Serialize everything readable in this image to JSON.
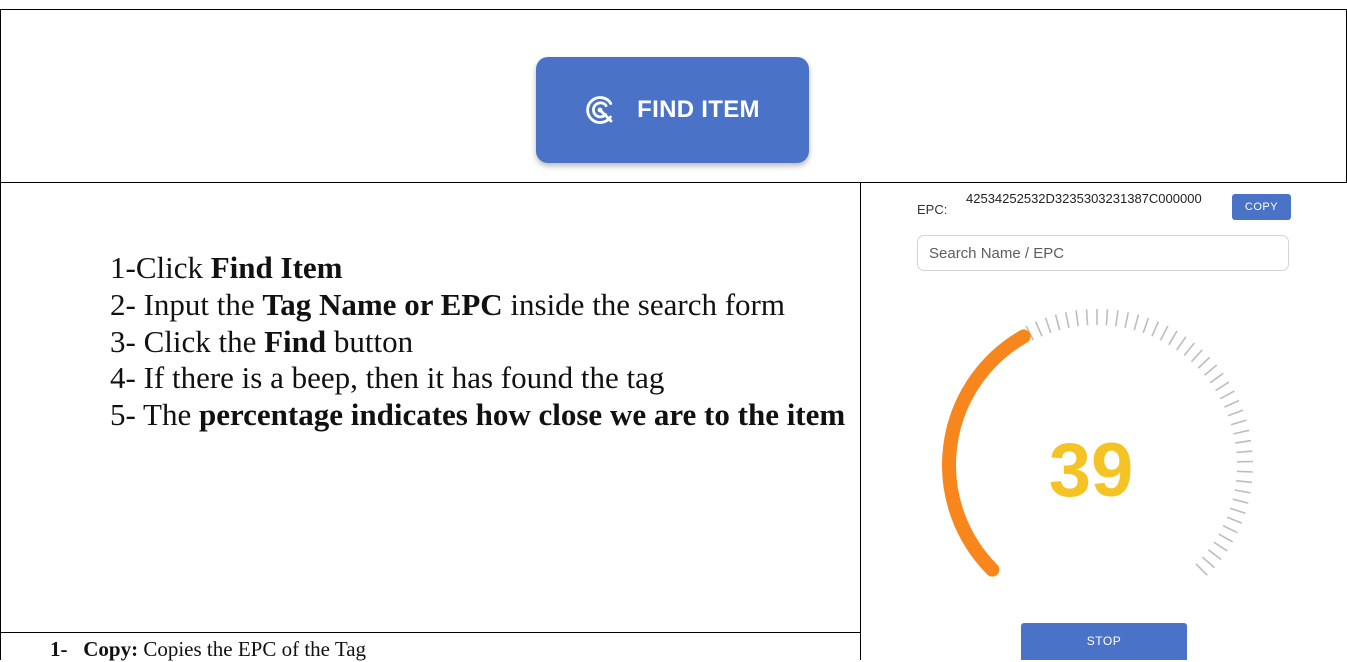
{
  "header": {
    "find_button": {
      "label": "FIND ITEM",
      "icon": "radar-icon",
      "color": "#4a73c7"
    }
  },
  "instructions": {
    "step1": {
      "prefix": "1-Click ",
      "bold": "Find Item"
    },
    "step2": {
      "prefix": "2- Input the ",
      "bold": "Tag Name or EPC",
      "suffix": " inside the search form"
    },
    "step3": {
      "prefix": "3- Click the ",
      "bold": "Find",
      "suffix": " button"
    },
    "step4": {
      "text": "4- If there is a beep, then it has found the tag"
    },
    "step5": {
      "prefix": "5- The ",
      "bold": "percentage indicates how close we are to the item"
    }
  },
  "footer_note": {
    "number": "1-",
    "bold": "Copy:",
    "text": " Copies the EPC of the Tag"
  },
  "app": {
    "epc_label": "EPC:",
    "epc_value": "42534252532D3235303231387C000000",
    "copy_label": "COPY",
    "search_placeholder": "Search Name / EPC",
    "gauge_value": "39",
    "gauge_percent": 39,
    "stop_label": "STOP",
    "colors": {
      "arc": "#f7861c",
      "value": "#f5c324",
      "ticks": "#bdbdbd",
      "accent": "#4a73c7"
    }
  }
}
